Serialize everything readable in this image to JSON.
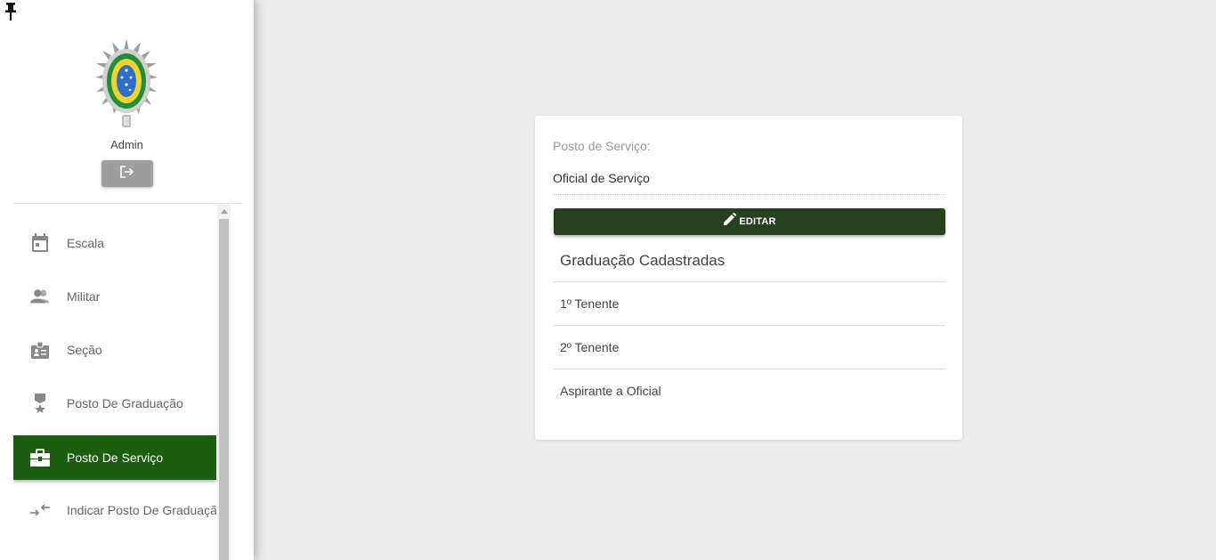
{
  "sidebar": {
    "user": "Admin",
    "nav": [
      {
        "label": "Escala",
        "icon": "calendar-icon"
      },
      {
        "label": "Militar",
        "icon": "people-icon"
      },
      {
        "label": "Seção",
        "icon": "badge-icon"
      },
      {
        "label": "Posto De Graduação",
        "icon": "medal-icon"
      },
      {
        "label": "Posto De Serviço",
        "icon": "briefcase-icon",
        "active": true
      },
      {
        "label": "Indicar Posto De Graduação",
        "icon": "compare-arrows-icon"
      }
    ]
  },
  "card": {
    "field_label": "Posto de Serviço:",
    "field_value": "Oficial de Serviço",
    "edit_label": "EDITAR",
    "list_title": "Graduação Cadastradas",
    "items": [
      "1º Tenente",
      "2º Tenente",
      "Aspirante a Oficial"
    ]
  },
  "colors": {
    "accent_active": "#1b5e0f",
    "button_dark": "#25411f",
    "background": "#ececec"
  }
}
